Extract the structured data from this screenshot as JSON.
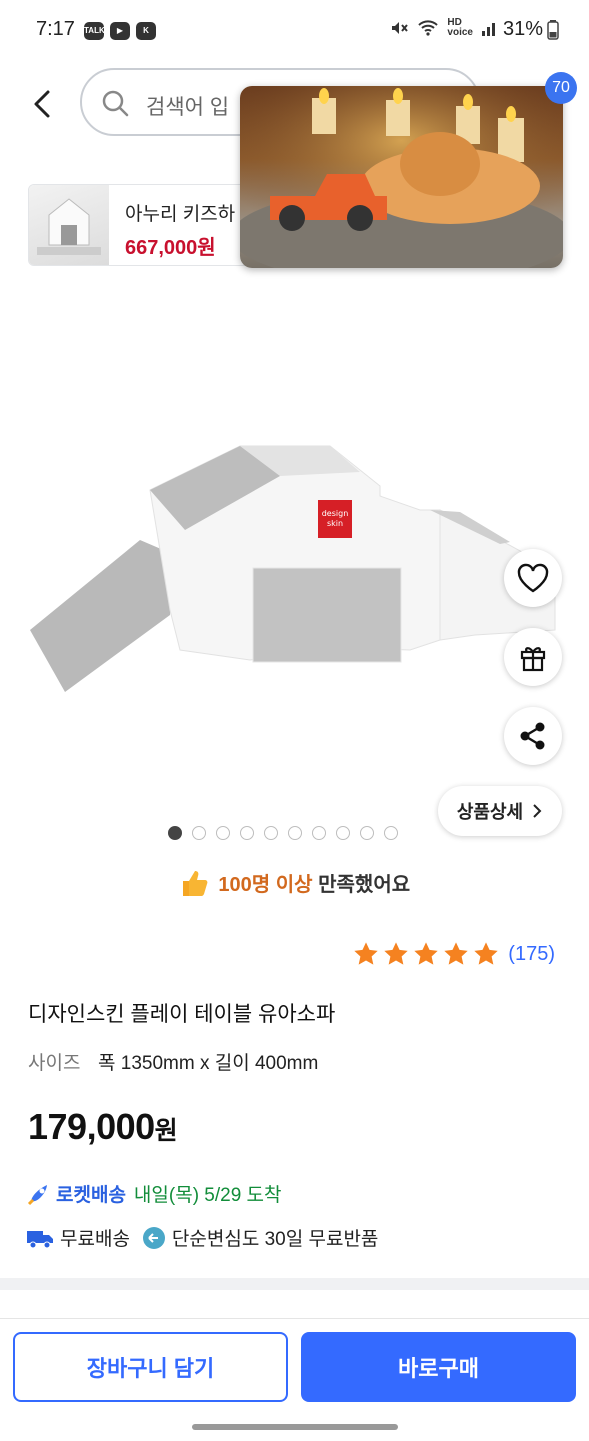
{
  "status_bar": {
    "time": "7:17",
    "left_icons": [
      "talk-icon",
      "youtube-icon",
      "app-icon"
    ],
    "right_text": "31%",
    "right_icons": [
      "mute-icon",
      "wifi-icon",
      "hd-voice-icon",
      "signal-icon",
      "battery-icon"
    ]
  },
  "header": {
    "search_placeholder": "검색어 입",
    "cart_count": "70"
  },
  "ad_banner": {
    "name": "아누리 키즈하",
    "price": "667,000원"
  },
  "product": {
    "image_alt": "디자인스킨 플레이 테이블 유아소파",
    "image_count": 10,
    "active_image": 0,
    "side_actions": [
      "heart-icon",
      "gift-icon",
      "share-icon"
    ],
    "detail_button": "상품상세",
    "satisfaction": {
      "highlight": "100명 이상",
      "rest": " 만족했어요"
    },
    "rating": 5,
    "review_count": "(175)",
    "title": "디자인스킨 플레이 테이블 유아소파",
    "option_label": "사이즈",
    "option_value": "폭 1350mm x 길이 400mm",
    "price_number": "179,000",
    "price_unit": "원",
    "delivery": {
      "brand": "로켓배송",
      "eta": "내일(목) 5/29 도착"
    },
    "free_shipping": "무료배송",
    "return_policy": "단순변심도 30일 무료반품"
  },
  "bottom_bar": {
    "cart_button": "장바구니 담기",
    "buy_button": "바로구매"
  },
  "colors": {
    "accent": "#346aff",
    "price_red": "#c8102e",
    "rocket_green": "#128d3a",
    "star": "#f58220"
  }
}
